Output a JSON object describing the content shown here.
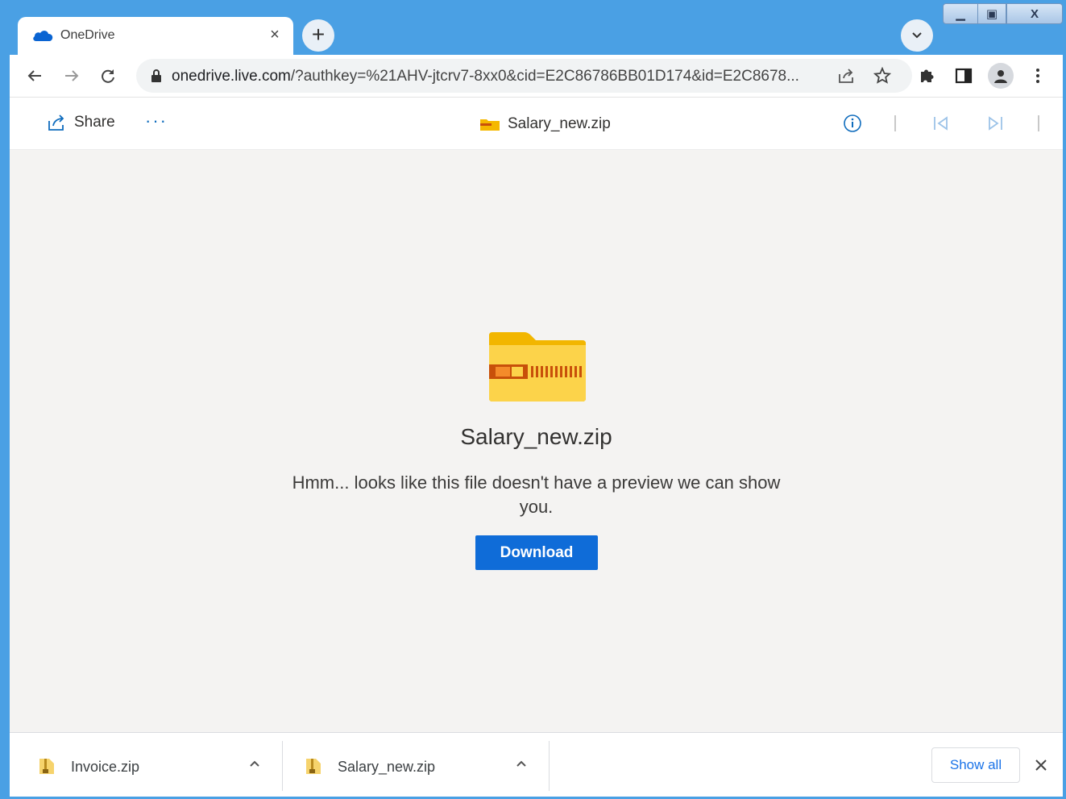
{
  "browser": {
    "tab_title": "OneDrive",
    "url_host": "onedrive.live.com",
    "url_path": "/?authkey=%21AHV-jtcrv7-8xx0&cid=E2C86786BB01D174&id=E2C8678...",
    "accent_color": "#4aa0e4"
  },
  "command_bar": {
    "share_label": "Share",
    "more_label": "···",
    "file_title": "Salary_new.zip"
  },
  "main": {
    "file_name": "Salary_new.zip",
    "message": "Hmm... looks like this file doesn't have a preview we can show you.",
    "download_label": "Download",
    "button_color": "#0f6cd8"
  },
  "downloads": {
    "items": [
      {
        "name": "Invoice.zip"
      },
      {
        "name": "Salary_new.zip"
      }
    ],
    "show_all_label": "Show all"
  },
  "icons": {
    "window_minimize": "minimize-icon",
    "window_maximize": "maximize-icon",
    "window_close": "close-icon"
  }
}
